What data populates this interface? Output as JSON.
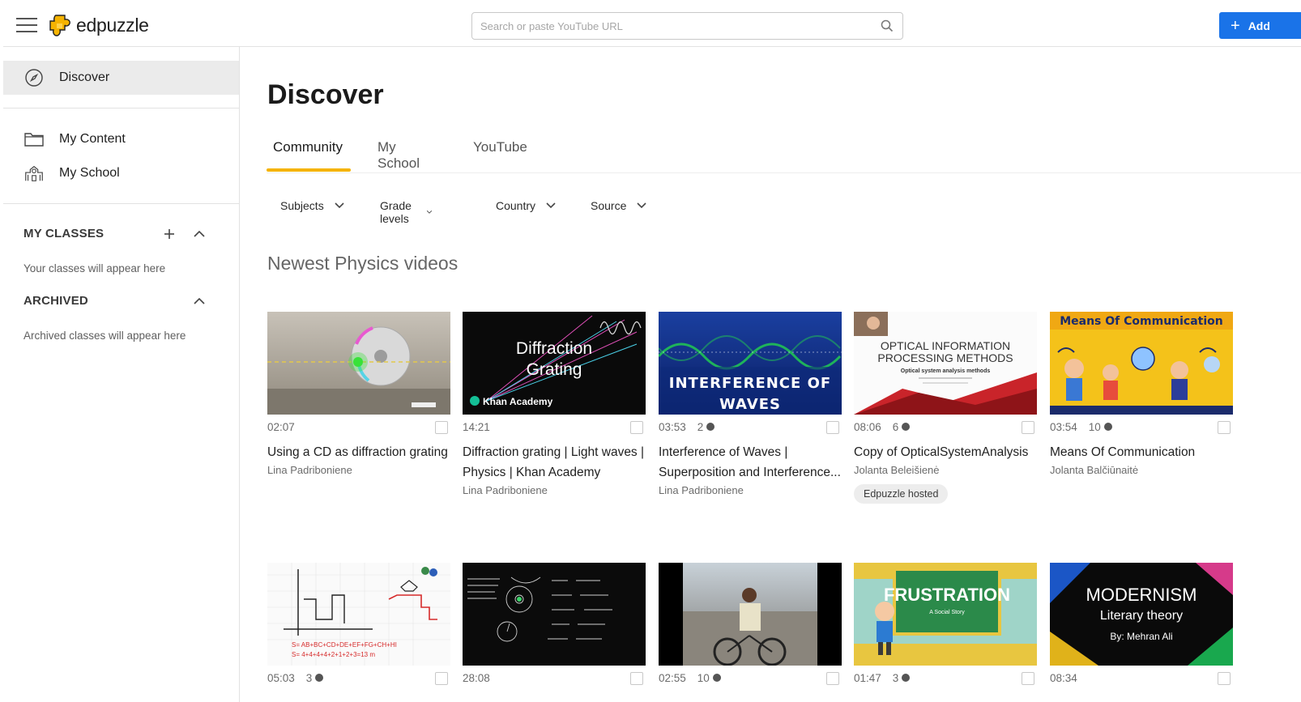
{
  "app": {
    "logo_text": "edpuzzle"
  },
  "search": {
    "placeholder": "Search or paste YouTube URL"
  },
  "header": {
    "add_label": "Add"
  },
  "sidebar": {
    "discover": "Discover",
    "my_content": "My Content",
    "my_school": "My School",
    "my_classes_title": "MY CLASSES",
    "my_classes_hint": "Your classes will appear here",
    "archived_title": "ARCHIVED",
    "archived_hint": "Archived classes will appear here"
  },
  "main": {
    "title": "Discover",
    "tabs": [
      {
        "label": "Community",
        "active": true
      },
      {
        "label": "My School"
      },
      {
        "label": "YouTube"
      }
    ],
    "filters": [
      "Subjects",
      "Grade levels",
      "Country",
      "Source"
    ],
    "section_heading": "Newest Physics videos"
  },
  "videos": [
    {
      "duration": "02:07",
      "questions": "",
      "title": "Using a CD as diffraction grating",
      "author": "Lina Padriboniene",
      "badge": "",
      "thumb": "cd"
    },
    {
      "duration": "14:21",
      "questions": "",
      "title": "Diffraction grating | Light waves | Physics | Khan Academy",
      "author": "Lina Padriboniene",
      "badge": "",
      "thumb": "khan",
      "thumb_text": [
        "Diffraction",
        "Grating",
        "Khan Academy"
      ]
    },
    {
      "duration": "03:53",
      "questions": "2",
      "title": "Interference of Waves | Superposition and Interference...",
      "author": "Lina Padriboniene",
      "badge": "",
      "thumb": "waves",
      "thumb_text": [
        "INTERFERENCE OF",
        "WAVES"
      ]
    },
    {
      "duration": "08:06",
      "questions": "6",
      "title": "Copy of OpticalSystemAnalysis",
      "author": "Jolanta Beleišienė",
      "badge": "Edpuzzle hosted",
      "thumb": "optical",
      "thumb_text": [
        "OPTICAL INFORMATION",
        "PROCESSING METHODS",
        "Optical system analysis methods"
      ]
    },
    {
      "duration": "03:54",
      "questions": "10",
      "title": "Means Of Communication",
      "author": "Jolanta Balčiūnaitė",
      "badge": "",
      "thumb": "comm",
      "thumb_text": [
        "Means Of Communication"
      ]
    },
    {
      "duration": "05:03",
      "questions": "3",
      "title": "",
      "author": "",
      "badge": "",
      "thumb": "graph"
    },
    {
      "duration": "28:08",
      "questions": "",
      "title": "",
      "author": "",
      "badge": "",
      "thumb": "blackboard"
    },
    {
      "duration": "02:55",
      "questions": "10",
      "title": "",
      "author": "",
      "badge": "",
      "thumb": "bike"
    },
    {
      "duration": "01:47",
      "questions": "3",
      "title": "",
      "author": "",
      "badge": "",
      "thumb": "frustration",
      "thumb_text": [
        "FRUSTRATION",
        "A Social Story"
      ]
    },
    {
      "duration": "08:34",
      "questions": "",
      "title": "",
      "author": "",
      "badge": "",
      "thumb": "modernism",
      "thumb_text": [
        "MODERNISM",
        "Literary theory",
        "By: Mehran Ali"
      ]
    }
  ],
  "colors": {
    "accent": "#f5b301",
    "primary_button": "#1a73e8"
  }
}
